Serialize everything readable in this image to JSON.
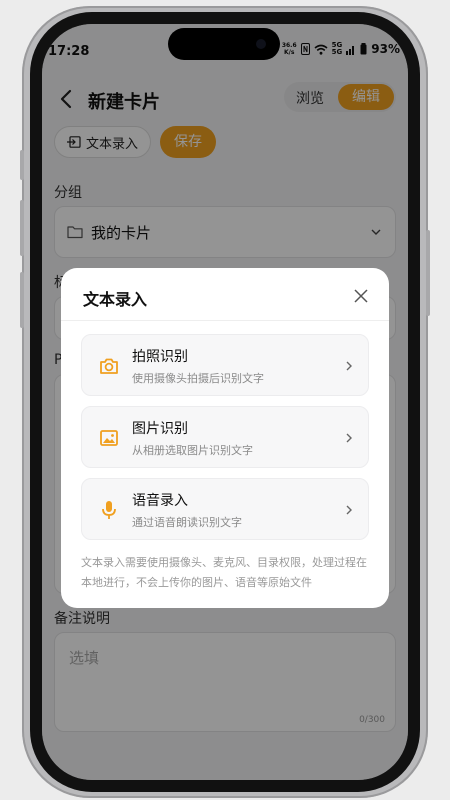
{
  "status_bar": {
    "time": "17:28",
    "net_speed_value": "36.6",
    "net_speed_unit": "K/s",
    "signal_label": "5G",
    "battery": "93%"
  },
  "header": {
    "title": "新建卡片",
    "browse_label": "浏览",
    "edit_label": "编辑"
  },
  "toolbar": {
    "text_entry_label": "文本录入",
    "save_label": "保存"
  },
  "form": {
    "group_label": "分组",
    "group_value": "我的卡片",
    "partial_label_1": "标",
    "partial_label_2": "P",
    "notes_label": "备注说明",
    "notes_placeholder": "选填",
    "notes_counter": "0/300"
  },
  "modal": {
    "title": "文本录入",
    "options": [
      {
        "title": "拍照识别",
        "desc": "使用摄像头拍摄后识别文字",
        "icon": "camera-icon"
      },
      {
        "title": "图片识别",
        "desc": "从相册选取图片识别文字",
        "icon": "image-icon"
      },
      {
        "title": "语音录入",
        "desc": "通过语音朗读识别文字",
        "icon": "microphone-icon"
      }
    ],
    "note": "文本录入需要使用摄像头、麦克风、目录权限，处理过程在本地进行，不会上传你的图片、语音等原始文件"
  },
  "colors": {
    "accent": "#f0a020",
    "icon_orange": "#f0a020"
  }
}
